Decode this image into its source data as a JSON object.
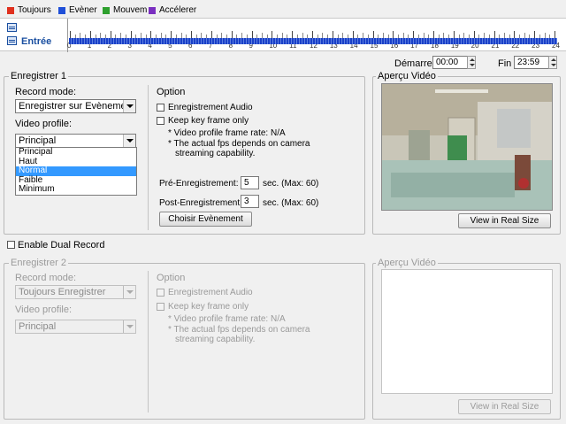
{
  "legend": [
    {
      "label": "Toujours",
      "color": "#e0301e"
    },
    {
      "label": "Evèner",
      "color": "#1f4fd8"
    },
    {
      "label": "Mouvem",
      "color": "#2ea02e"
    },
    {
      "label": "Accélerer",
      "color": "#7a2fc0"
    }
  ],
  "timeline": {
    "row_label": "Entrée",
    "hours": [
      "0",
      "1",
      "2",
      "3",
      "4",
      "5",
      "6",
      "7",
      "8",
      "9",
      "10",
      "11",
      "12",
      "13",
      "14",
      "15",
      "16",
      "17",
      "18",
      "19",
      "20",
      "21",
      "22",
      "23",
      "24"
    ]
  },
  "schedule": {
    "start_label": "Démarrer",
    "start_value": "00:00",
    "end_label": "Fin",
    "end_value": "23:59"
  },
  "group1": {
    "title": "Enregistrer 1",
    "record_mode_label": "Record mode:",
    "record_mode_value": "Enregistrer sur Evènement",
    "video_profile_label": "Video profile:",
    "video_profile_value": "Principal",
    "profile_options": [
      "Principal",
      "Haut",
      "Normal",
      "Faible",
      "Minimum"
    ],
    "option_title": "Option",
    "audio_label": "Enregistrement Audio",
    "keyframe_label": "Keep key frame only",
    "note1": "* Video profile frame rate: N/A",
    "note2": "* The actual fps depends on camera",
    "note3": "streaming capability.",
    "pre_label": "Pré-Enregistrement:",
    "pre_value": "5",
    "pre_unit": "sec.  (Max: 60)",
    "post_label": "Post-Enregistrement:",
    "post_value": "3",
    "post_unit": "sec.  (Max: 60)",
    "choose_event_button": "Choisir Evènement"
  },
  "preview1": {
    "title": "Aperçu Vidéo",
    "button": "View in Real Size"
  },
  "dual_record_label": "Enable Dual Record",
  "group2": {
    "title": "Enregistrer 2",
    "record_mode_label": "Record mode:",
    "record_mode_value": "Toujours Enregistrer",
    "video_profile_label": "Video profile:",
    "video_profile_value": "Principal",
    "option_title": "Option",
    "audio_label": "Enregistrement Audio",
    "keyframe_label": "Keep key frame only",
    "note1": "* Video profile frame rate: N/A",
    "note2": "* The actual fps depends on camera",
    "note3": "streaming capability."
  },
  "preview2": {
    "title": "Aperçu Vidéo",
    "button": "View in Real Size"
  }
}
